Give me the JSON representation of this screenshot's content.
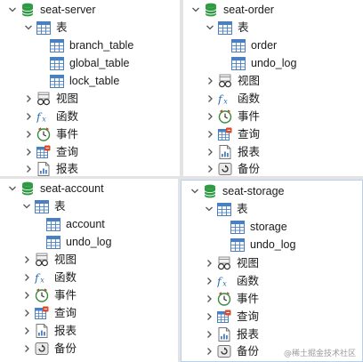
{
  "panels": [
    {
      "db_name": "seat-server",
      "table_group": "表",
      "tables": [
        "branch_table",
        "global_table",
        "lock_table"
      ],
      "items": [
        "视图",
        "函数",
        "事件",
        "查询",
        "报表"
      ]
    },
    {
      "db_name": "seat-order",
      "table_group": "表",
      "tables": [
        "order",
        "undo_log"
      ],
      "items": [
        "视图",
        "函数",
        "事件",
        "查询",
        "报表",
        "备份"
      ]
    },
    {
      "db_name": "seat-account",
      "table_group": "表",
      "tables": [
        "account",
        "undo_log"
      ],
      "items": [
        "视图",
        "函数",
        "事件",
        "查询",
        "报表",
        "备份"
      ]
    },
    {
      "db_name": "seat-storage",
      "table_group": "表",
      "tables": [
        "storage",
        "undo_log"
      ],
      "items": [
        "视图",
        "函数",
        "事件",
        "查询",
        "报表",
        "备份"
      ]
    }
  ],
  "item_icons": [
    "view-icon",
    "function-icon",
    "event-icon",
    "query-icon",
    "report-icon",
    "backup-icon"
  ],
  "watermark": "@稀土掘金技术社区",
  "colors": {
    "db_icon": "#2e9a44",
    "table_icon": "#4a7fc1",
    "function_icon": "#2a6fb5",
    "chevron": "#555555"
  }
}
